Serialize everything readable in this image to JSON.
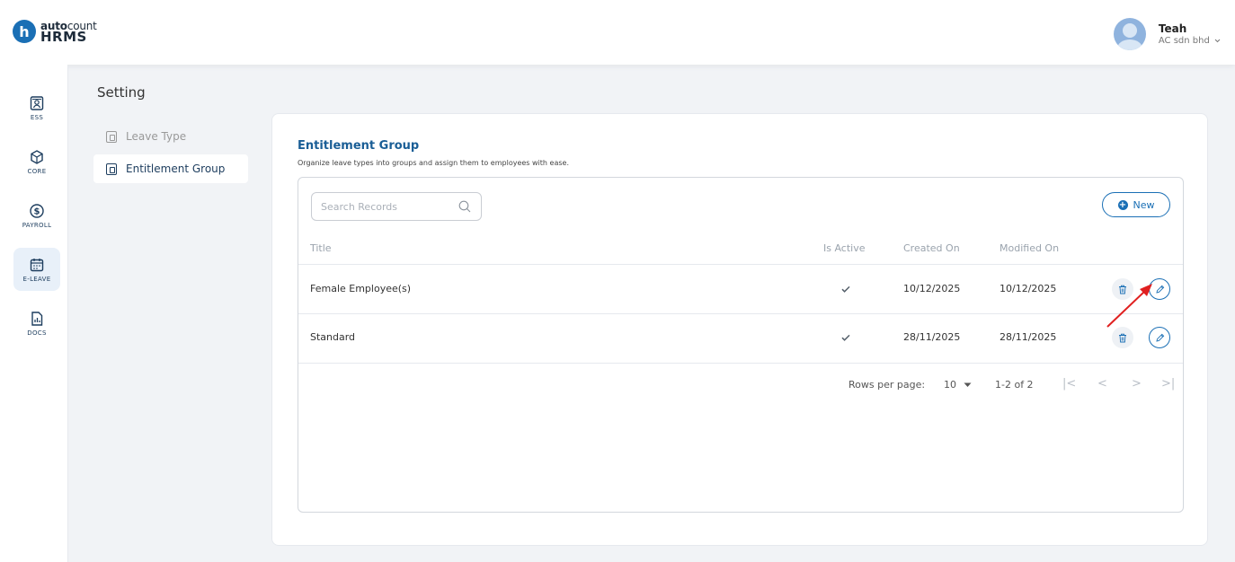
{
  "brand": {
    "logo_letter": "h",
    "name_top_bold": "auto",
    "name_top_rest": "count",
    "name_bottom": "HRMS"
  },
  "user": {
    "name": "Teah",
    "company": "AC sdn bhd"
  },
  "sidebar": {
    "items": [
      {
        "label": "ESS",
        "icon": "ess-icon"
      },
      {
        "label": "CORE",
        "icon": "core-icon"
      },
      {
        "label": "PAYROLL",
        "icon": "payroll-icon"
      },
      {
        "label": "E-LEAVE",
        "icon": "calendar-icon",
        "active": true
      },
      {
        "label": "DOCS",
        "icon": "docs-icon"
      }
    ]
  },
  "setting": {
    "title": "Setting",
    "menu": [
      {
        "label": "Leave Type",
        "active": false
      },
      {
        "label": "Entitlement Group",
        "active": true
      }
    ]
  },
  "card": {
    "title": "Entitlement Group",
    "subtitle": "Organize leave types into groups and assign them to employees with ease."
  },
  "table": {
    "search_placeholder": "Search Records",
    "new_label": "New",
    "columns": {
      "title": "Title",
      "is_active": "Is Active",
      "created_on": "Created On",
      "modified_on": "Modified On"
    },
    "rows": [
      {
        "title": "Female Employee(s)",
        "is_active": true,
        "created_on": "10/12/2025",
        "modified_on": "10/12/2025"
      },
      {
        "title": "Standard",
        "is_active": true,
        "created_on": "28/11/2025",
        "modified_on": "28/11/2025"
      }
    ],
    "pagination": {
      "rows_per_page_label": "Rows per page:",
      "rows_per_page": "10",
      "range": "1-2 of 2"
    }
  },
  "colors": {
    "accent": "#1a6fb5",
    "annotation_arrow": "#e02020"
  }
}
